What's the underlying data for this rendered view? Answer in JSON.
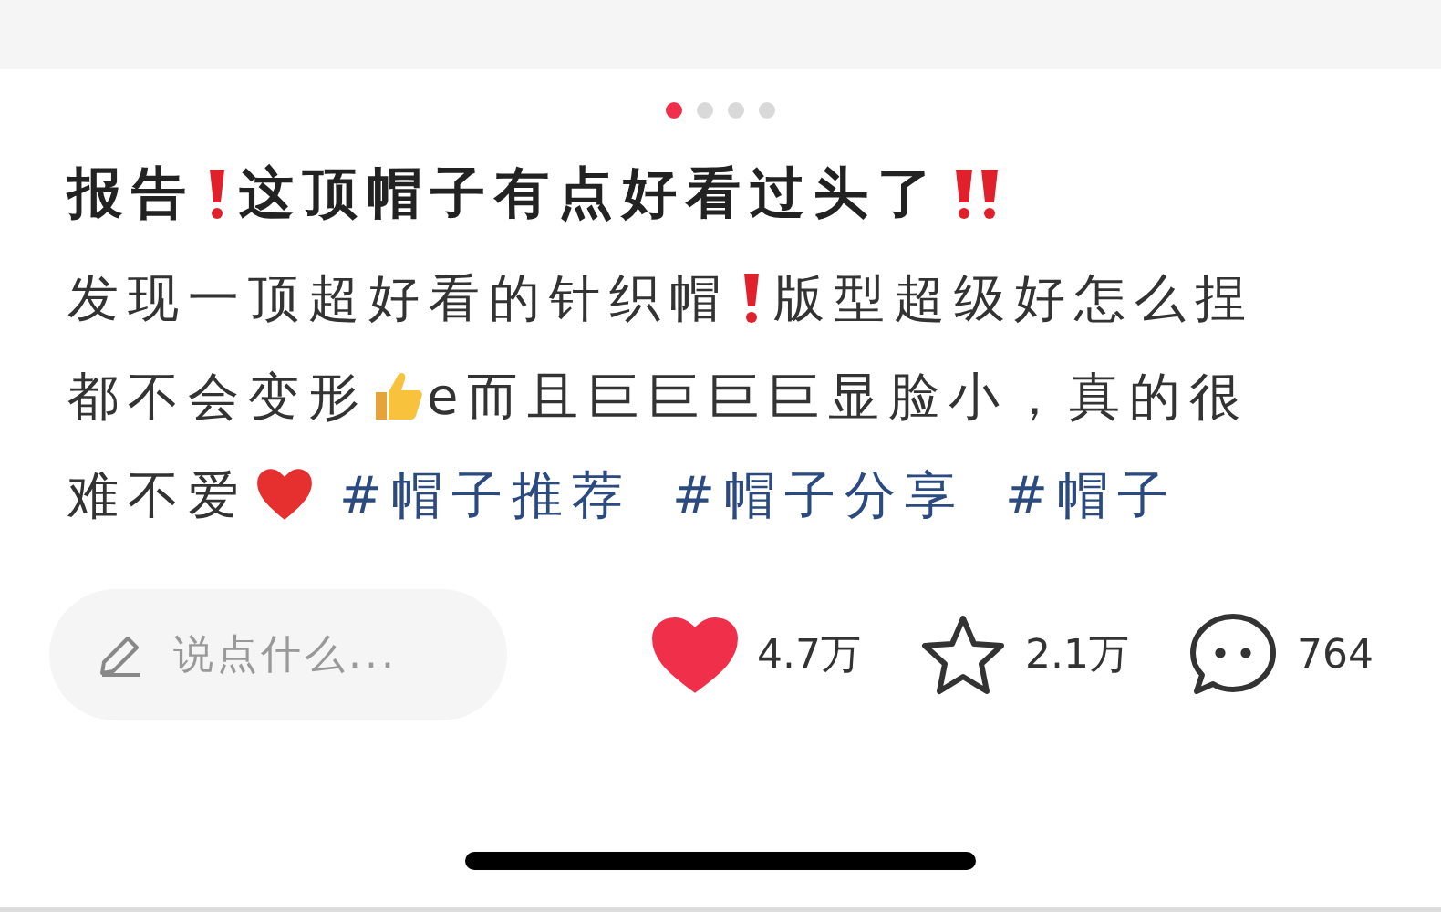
{
  "carousel_dots": [
    {
      "selected": true
    },
    {
      "selected": false
    },
    {
      "selected": false
    },
    {
      "selected": false
    }
  ],
  "title": [
    {
      "kind": "text",
      "text": "报告"
    },
    {
      "kind": "exclaim"
    },
    {
      "kind": "text",
      "text": "这顶帽子有点好看过头了"
    },
    {
      "kind": "doubleexclaim"
    }
  ],
  "body": [
    {
      "kind": "text",
      "text": "发现一顶超好看的针织帽"
    },
    {
      "kind": "exclaim"
    },
    {
      "kind": "text",
      "text": "版型超级好怎么捏"
    },
    {
      "kind": "text",
      "text": "都不会变形"
    },
    {
      "kind": "thumbs"
    },
    {
      "kind": "text",
      "text": "e而且巨巨巨巨显脸小，真的很"
    },
    {
      "kind": "text",
      "text": "难不爱"
    },
    {
      "kind": "heart"
    },
    {
      "kind": "tag",
      "text": "#帽子推荐"
    },
    {
      "kind": "tag",
      "text": "#帽子分享"
    },
    {
      "kind": "tag",
      "text": "#帽子"
    }
  ],
  "comment_field": {
    "placeholder": "说点什么..."
  },
  "actions": [
    {
      "kind": "like",
      "count": "4.7万",
      "selected": true
    },
    {
      "kind": "collect",
      "count": "2.1万",
      "selected": false
    },
    {
      "kind": "comment",
      "count": "764"
    }
  ]
}
